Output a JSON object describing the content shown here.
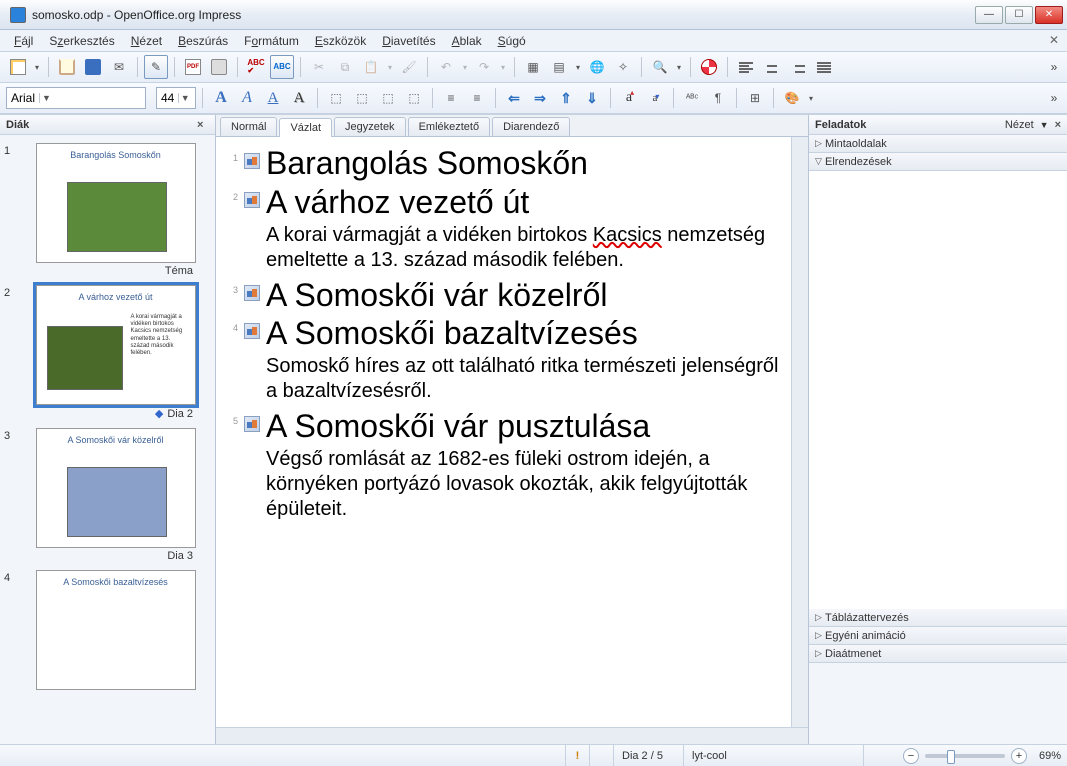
{
  "window": {
    "title": "somosko.odp - OpenOffice.org Impress"
  },
  "menu": [
    "Fájl",
    "Szerkesztés",
    "Nézet",
    "Beszúrás",
    "Formátum",
    "Eszközök",
    "Diavetítés",
    "Ablak",
    "Súgó"
  ],
  "font": {
    "name": "Arial",
    "size": "44"
  },
  "slides_panel": {
    "title": "Diák",
    "items": [
      {
        "num": "1",
        "title": "Barangolás Somoskőn",
        "caption": "Téma",
        "selected": false
      },
      {
        "num": "2",
        "title": "A várhoz vezető út",
        "body": "A korai vármagját a vidéken birtokos Kacsics nemzetség emeltette a 13. század második felében.",
        "caption": "Dia 2",
        "selected": true
      },
      {
        "num": "3",
        "title": "A Somoskői vár közelről",
        "caption": "Dia 3",
        "selected": false
      },
      {
        "num": "4",
        "title": "A Somoskői bazaltvízesés",
        "caption": "",
        "selected": false
      }
    ]
  },
  "view_tabs": [
    "Normál",
    "Vázlat",
    "Jegyzetek",
    "Emlékeztető",
    "Diarendező"
  ],
  "active_tab": "Vázlat",
  "outline": [
    {
      "n": "1",
      "title": "Barangolás Somoskőn"
    },
    {
      "n": "2",
      "title": "A várhoz vezető út",
      "body": "A korai vármagját a vidéken birtokos Kacsics nemzetség emeltette a 13. század második felében.",
      "red_word": "Kacsics"
    },
    {
      "n": "3",
      "title": "A Somoskői vár közelről"
    },
    {
      "n": "4",
      "title": "A Somoskői bazaltvízesés",
      "body": "Somoskő híres az ott található ritka természeti jelenségről a bazaltvízesésről."
    },
    {
      "n": "5",
      "title": "A Somoskői vár pusztulása",
      "body": "Végső romlását az 1682-es füleki ostrom idején, a környéken portyázó lovasok okozták, akik felgyújtották épületeit."
    }
  ],
  "tasks": {
    "title": "Feladatok",
    "view_label": "Nézet",
    "sections": [
      "Mintaoldalak",
      "Elrendezések",
      "Táblázattervezés",
      "Egyéni animáció",
      "Diaátmenet"
    ],
    "open_section": "Elrendezések"
  },
  "status": {
    "exclaim": "!",
    "slide": "Dia 2 / 5",
    "layout": "lyt-cool",
    "zoom": "69%"
  }
}
